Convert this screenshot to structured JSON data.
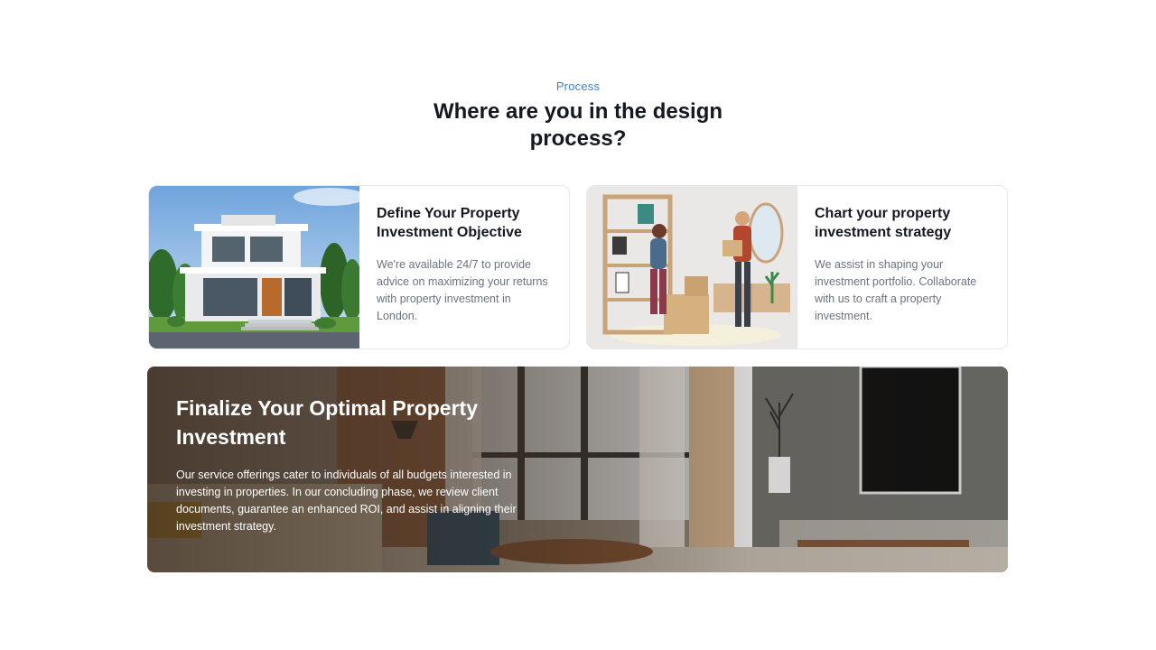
{
  "section": {
    "eyebrow": "Process",
    "title": "Where are you in the design process?"
  },
  "cards": [
    {
      "title": "Define Your Property Investment Objective",
      "text": "We're available 24/7 to provide advice on maximizing your returns with property investment in London.",
      "image": "modern-house-illustration"
    },
    {
      "title": "Chart your property investment strategy",
      "text": "We assist in shaping your investment portfolio. Collaborate with us to craft a property investment.",
      "image": "people-moving-boxes-illustration"
    }
  ],
  "banner": {
    "title": "Finalize Your Optimal Property Investment",
    "text": "Our service offerings cater to individuals of all budgets interested in investing in properties. In our concluding phase, we review client documents, guarantee an enhanced ROI, and assist in aligning their investment strategy.",
    "image": "living-room-interior-photo"
  },
  "colors": {
    "accent": "#3b82d6",
    "heading": "#141821",
    "body_text": "#6b7380",
    "card_border": "#e6e8ec"
  }
}
